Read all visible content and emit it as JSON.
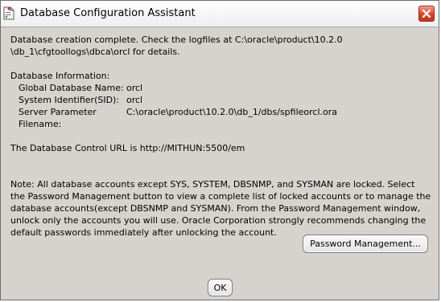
{
  "window": {
    "title": "Database Configuration Assistant",
    "app_icon": "document-icon",
    "close_icon": "close-x-icon"
  },
  "message": {
    "completion_line1": "Database creation complete. Check the logfiles at C:\\oracle\\product\\10.2.0",
    "completion_line2": "\\db_1\\cfgtoollogs\\dbca\\orcl for details.",
    "info_heading": "Database Information:",
    "info": [
      {
        "label": "Global Database Name:",
        "value": "orcl"
      },
      {
        "label": "System Identifier(SID):",
        "value": "orcl"
      },
      {
        "label": "Server Parameter Filename:",
        "value": "C:\\oracle\\product\\10.2.0\\db_1/dbs/spfileorcl.ora"
      }
    ],
    "control_url": "The Database Control URL is http://MITHUN:5500/em",
    "note_lines": [
      "Note: All database accounts except SYS, SYSTEM, DBSNMP, and SYSMAN are locked. Select",
      "the Password Management button to view a complete list of locked accounts or to manage the",
      "database accounts(except DBSNMP and SYSMAN). From the Password Management window,",
      "unlock only the accounts you will use. Oracle Corporation strongly recommends changing the",
      "default passwords immediately after unlocking the account."
    ]
  },
  "buttons": {
    "password_management": "Password Management...",
    "ok": "OK"
  }
}
